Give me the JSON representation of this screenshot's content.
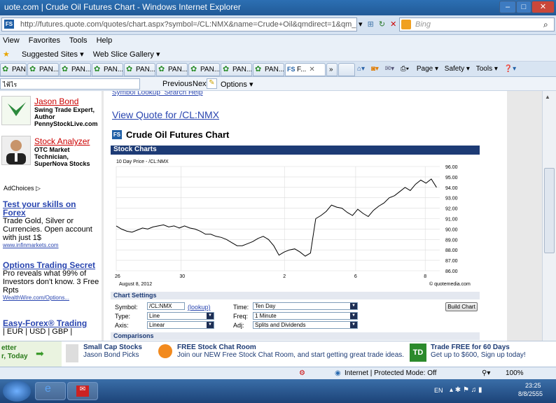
{
  "window": {
    "title": "uote.com | Crude Oil Futures Chart - Windows Internet Explorer"
  },
  "address_bar": {
    "url": "http://futures.quote.com/quotes/chart.aspx?symbol=/CL:NMX&name=Crude+Oil&qmdirect=1&qm_page=19384",
    "search_placeholder": "Bing"
  },
  "menu": [
    "View",
    "Favorites",
    "Tools",
    "Help"
  ],
  "favorites_bar": {
    "suggested": "Suggested Sites ▾",
    "slice": "Web Slice Gallery ▾"
  },
  "tabs": [
    "PAN...",
    "PAN...",
    "PAN...",
    "PAN...",
    "PAN...",
    "PAN...",
    "PAN...",
    "PAN...",
    "PAN...",
    "F..."
  ],
  "command_bar": {
    "page": "Page ▾",
    "safety": "Safety ▾",
    "tools": "Tools ▾"
  },
  "find_bar": {
    "value": "ไฟ้ไร",
    "previous": "Previous",
    "next": "Next",
    "options": "Options ▾"
  },
  "sidebar": {
    "promos": [
      {
        "name": "Jason Bond",
        "desc": "Swing Trade Expert, Author PennyStockLive.com"
      },
      {
        "name": "Stock Analyzer",
        "desc": "OTC Market Technician, SuperNova Stocks"
      }
    ],
    "adchoices": "AdChoices ▷",
    "ads": [
      {
        "title": "Test your skills on Forex",
        "body": "Trade Gold, Silver or Currencies. Open account with just 1$",
        "url": "www.infinmarkets.com"
      },
      {
        "title": "Options Trading Secret",
        "body": "Pro reveals what 99% of Investors don't know. 3 Free Rpts",
        "url": "WealthWire.com/Options..."
      },
      {
        "title": "Easy-Forex® Trading",
        "body": "| EUR | USD | GBP |",
        "url": ""
      }
    ]
  },
  "main": {
    "top_links": "Symbol Lookup  Search Help",
    "view_quote": "View Quote for /CL:NMX",
    "page_title": "Crude Oil Futures Chart",
    "chart_header": "Stock Charts",
    "settings_header": "Chart Settings",
    "comparisons_header": "Comparisons",
    "settings": {
      "symbol_label": "Symbol:",
      "symbol_value": "/CL:NMX",
      "lookup": "(lookup)",
      "time_label": "Time:",
      "time_value": "Ten Day",
      "type_label": "Type:",
      "type_value": "Line",
      "freq_label": "Freq:",
      "freq_value": "1 Minute",
      "axis_label": "Axis:",
      "axis_value": "Linear",
      "adj_label": "Adj:",
      "adj_value": "Splits and Dividends",
      "build": "Build Chart"
    }
  },
  "chart_data": {
    "type": "line",
    "title": "10 Day Price - /CL:NMX",
    "date_note": "August 8, 2012",
    "credit": "© quotemedia.com",
    "x_ticks": [
      "26",
      "30",
      "2",
      "6",
      "8"
    ],
    "ylim": [
      86,
      96
    ],
    "y_ticks": [
      "96.00",
      "95.00",
      "94.00",
      "93.00",
      "92.00",
      "91.00",
      "90.00",
      "89.00",
      "88.00",
      "87.00",
      "86.00"
    ],
    "series": [
      {
        "values": [
          90.3,
          90.0,
          89.8,
          89.7,
          89.9,
          90.1,
          90.0,
          90.2,
          90.3,
          90.4,
          90.2,
          90.3,
          90.1,
          90.3,
          90.1,
          90.0,
          89.8,
          89.5,
          89.5,
          89.3,
          89.2,
          89.0,
          88.7,
          88.4,
          88.4,
          88.6,
          88.8,
          89.1,
          89.3,
          89.0,
          88.4,
          87.5,
          87.8,
          88.0,
          88.1,
          87.8,
          87.4,
          87.7,
          91.0,
          91.3,
          91.7,
          92.3,
          92.1,
          92.0,
          91.6,
          91.3,
          91.9,
          91.5,
          91.2,
          91.8,
          92.2,
          92.5,
          93.0,
          93.2,
          93.6,
          94.0,
          93.7,
          94.3,
          94.7,
          94.4,
          94.8,
          94.0
        ]
      }
    ]
  },
  "bottom_bar": {
    "left": "etter\nr, Today",
    "promo1_title": "Small Cap Stocks",
    "promo1_sub": "Jason Bond Picks",
    "promo2_title": "FREE Stock Chat Room",
    "promo2_sub": "Join our NEW Free Stock Chat Room, and start getting great trade ideas.",
    "promo3_title": "Trade FREE for 60 Days",
    "promo3_sub": "Get up to $600, Sign up today!"
  },
  "status": {
    "zone": "Internet | Protected Mode: Off",
    "zoom": "100%"
  },
  "taskbar": {
    "lang": "EN",
    "time": "23:25",
    "date": "8/8/2555"
  }
}
